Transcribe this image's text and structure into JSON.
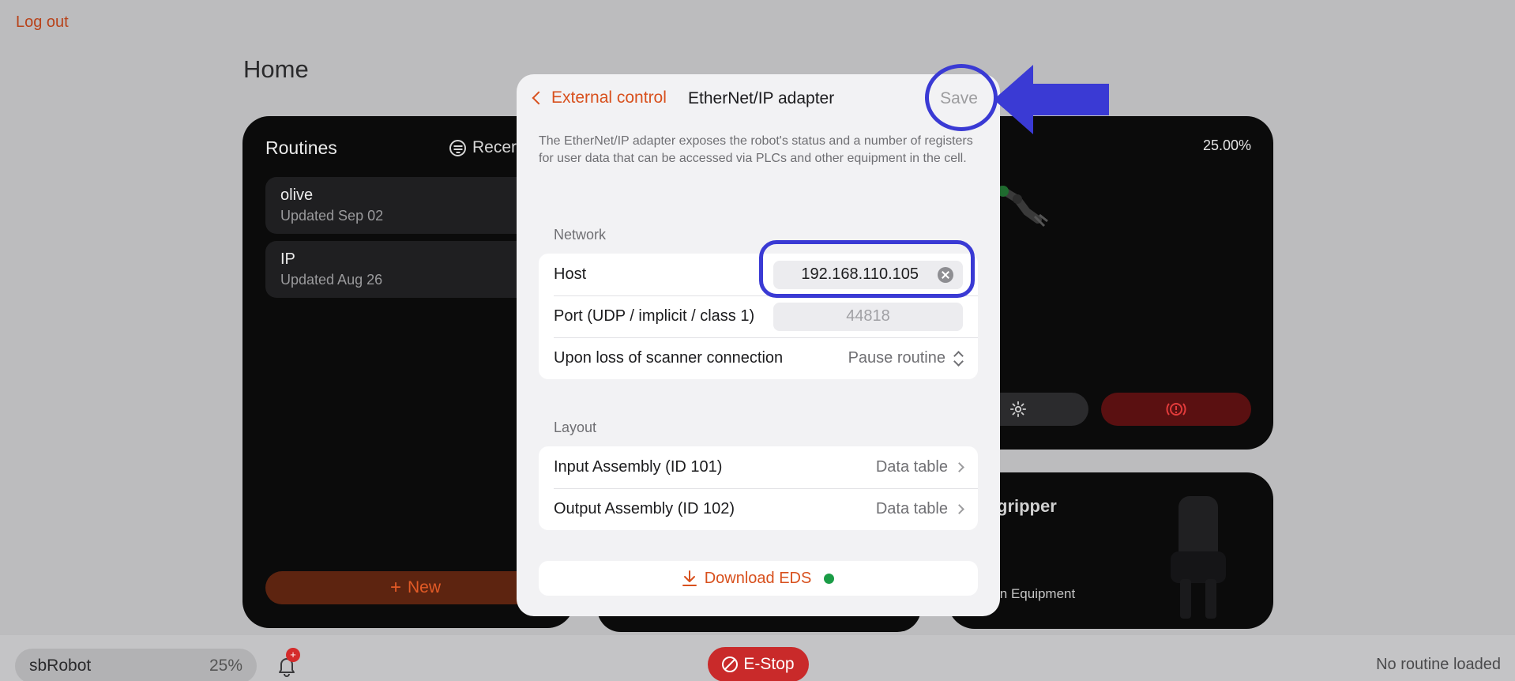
{
  "app": {
    "logout_label": "Log out",
    "page_title": "Home"
  },
  "routines": {
    "title": "Routines",
    "sort_label": "Recer",
    "items": [
      {
        "name": "olive",
        "updated": "Updated Sep 02"
      },
      {
        "name": "IP",
        "updated": "Updated Aug 26"
      }
    ],
    "new_label": "New"
  },
  "robot_card": {
    "speed": "25.00%"
  },
  "gripper_card": {
    "title": "gripper",
    "subtitle": "in Equipment"
  },
  "bottom_bar": {
    "robot_name": "sbRobot",
    "robot_speed": "25%",
    "notification_badge": "+",
    "estop_label": "E-Stop",
    "routine_status": "No routine loaded"
  },
  "modal": {
    "back_label": "External control",
    "title": "EtherNet/IP adapter",
    "save_label": "Save",
    "description": "The EtherNet/IP adapter exposes the robot's status and a number of registers for user data that can be accessed via PLCs and other equipment in the cell.",
    "network": {
      "section_label": "Network",
      "host_label": "Host",
      "host_value": "192.168.110.105",
      "port_label": "Port (UDP / implicit / class 1)",
      "port_placeholder": "44818",
      "loss_label": "Upon loss of scanner connection",
      "loss_value": "Pause routine"
    },
    "layout": {
      "section_label": "Layout",
      "rows": [
        {
          "label": "Input Assembly (ID 101)",
          "value": "Data table"
        },
        {
          "label": "Output Assembly (ID 102)",
          "value": "Data table"
        }
      ]
    },
    "download_label": "Download EDS",
    "download_status_color": "#1a9c46"
  },
  "colors": {
    "accent": "#d8501d",
    "annotation": "#3a3ad4",
    "estop": "#c92a2a"
  }
}
